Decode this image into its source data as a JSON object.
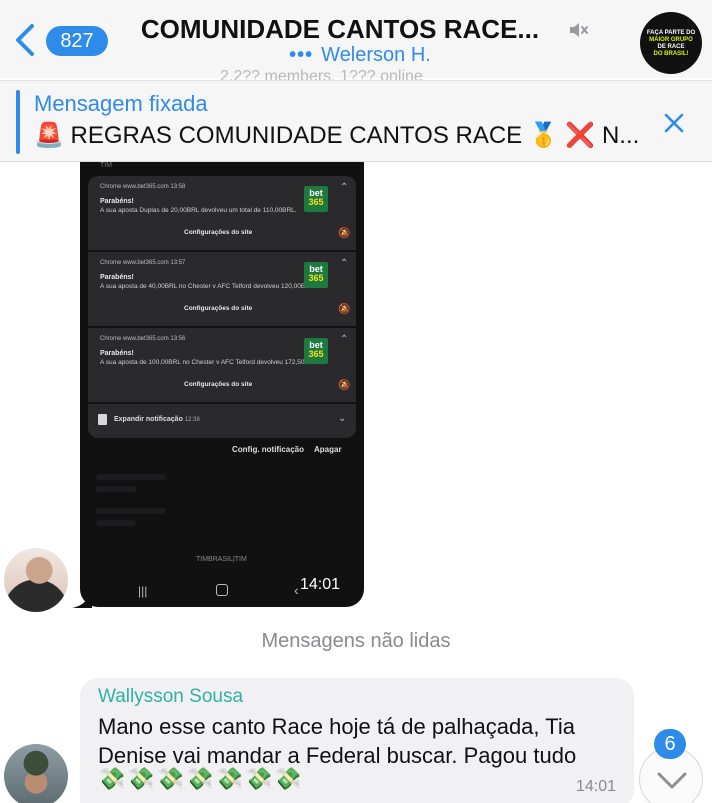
{
  "header": {
    "back_count": "827",
    "title": "COMUNIDADE CANTOS RACE...",
    "subtitle_dots": "•••",
    "subtitle": "Welerson H.",
    "member_line_ghost": "2.2?? members, 1??? online",
    "group_avatar_lines": [
      "FAÇA PARTE DO",
      "MAIOR GRUPO",
      "DE RACE",
      "DO BRASIL!"
    ]
  },
  "pinned": {
    "label": "Mensagem fixada",
    "text": "🚨 REGRAS COMUNIDADE CANTOS RACE 🥇 ❌ N..."
  },
  "image_message": {
    "top_cut": "TIM",
    "notifications": [
      {
        "header": "Chrome  www.bet365.com  13:58",
        "title": "Parabéns!",
        "body": "A sua aposta Duplas de 20,00BRL devolveu um total de 110,00BRL.",
        "button": "Configurações do site"
      },
      {
        "header": "Chrome  www.bet365.com  13:57",
        "title": "Parabéns!",
        "body": "A sua aposta de 40,00BRL no Chester v AFC Telford devolveu 120,00BRL.",
        "button": "Configurações do site"
      },
      {
        "header": "Chrome  www.bet365.com  13:56",
        "title": "Parabéns!",
        "body": "A sua aposta de 100,00BRL no Chester v AFC Telford devolveu 172,50BRL.",
        "button": "Configurações do site"
      }
    ],
    "bet_logo": {
      "top": "bet",
      "bottom": "365"
    },
    "expand": "Expandir notificação",
    "expand_time": "12:38",
    "config_button": "Config. notificação",
    "clear_button": "Apagar",
    "carrier": "TIMBRASIL|TIM",
    "time": "14:01"
  },
  "divider": {
    "unread": "Mensagens não lidas"
  },
  "text_message": {
    "sender": "Wallysson Sousa",
    "text": "Mano esse canto Race hoje tá de palhaçada, Tia Denise vai mandar a Federal buscar. Pagou tudo",
    "emoji": "💸💸💸💸💸💸💸",
    "time": "14:01"
  },
  "scroll": {
    "badge": "6"
  },
  "colors": {
    "accent": "#2f8bea",
    "sender": "#2fb1a6",
    "bubble": "#f1f1f3",
    "bet365": "#1c7a3f"
  }
}
